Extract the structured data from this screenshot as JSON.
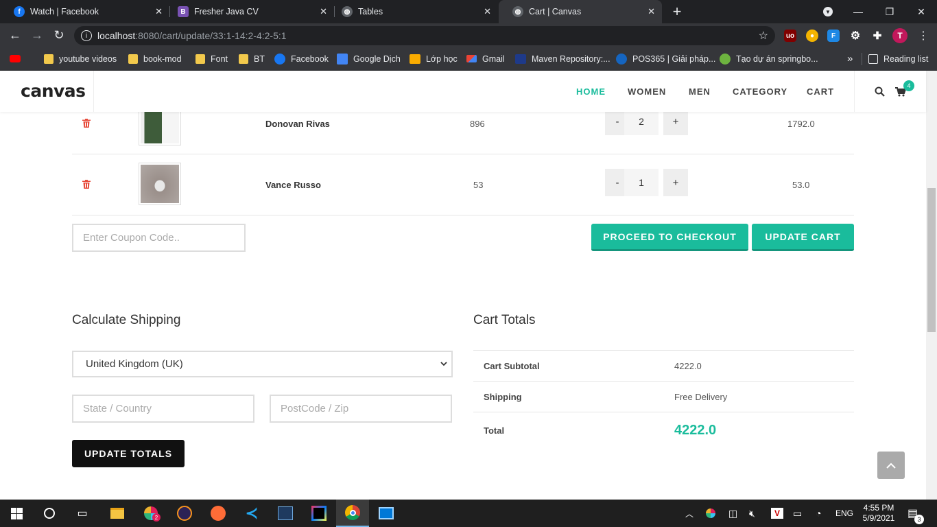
{
  "browser": {
    "tabs": [
      {
        "title": "Watch | Facebook",
        "icon": "facebook-icon"
      },
      {
        "title": "Fresher Java CV",
        "icon": "bootstrap-icon"
      },
      {
        "title": "Tables",
        "icon": "globe-icon"
      },
      {
        "title": "Cart | Canvas",
        "icon": "globe-icon",
        "active": true
      }
    ],
    "url_host": "localhost",
    "url_rest": ":8080/cart/update/33:1-14:2-4:2-5:1",
    "bookmarks": [
      "youtube videos",
      "book-mod",
      "Font",
      "BT",
      "Facebook",
      "Google Dịch",
      "Lớp học",
      "Gmail",
      "Maven Repository:...",
      "POS365 | Giải pháp...",
      "Tạo dự án springbo..."
    ],
    "bookmark_overflow": "»",
    "reading_list": "Reading list",
    "profile_initial": "T"
  },
  "site": {
    "logo": "canvas",
    "nav": [
      "HOME",
      "WOMEN",
      "MEN",
      "CATEGORY",
      "CART"
    ],
    "cart_count": "4",
    "accent": "#1abc9c"
  },
  "cart": {
    "items": [
      {
        "name": "Donovan Rivas",
        "price": "896",
        "qty": "2",
        "subtotal": "1792.0"
      },
      {
        "name": "Vance Russo",
        "price": "53",
        "qty": "1",
        "subtotal": "53.0"
      }
    ],
    "qty_minus": "-",
    "qty_plus": "+",
    "coupon_placeholder": "Enter Coupon Code..",
    "checkout_label": "PROCEED TO CHECKOUT",
    "update_cart_label": "UPDATE CART"
  },
  "shipping": {
    "heading": "Calculate Shipping",
    "country": "United Kingdom (UK)",
    "state_placeholder": "State / Country",
    "zip_placeholder": "PostCode / Zip",
    "update_totals_label": "UPDATE TOTALS"
  },
  "totals": {
    "heading": "Cart Totals",
    "rows": [
      {
        "label": "Cart Subtotal",
        "value": "4222.0"
      },
      {
        "label": "Shipping",
        "value": "Free Delivery"
      },
      {
        "label": "Total",
        "value": "4222.0"
      }
    ]
  },
  "taskbar": {
    "language": "ENG",
    "time": "4:55 PM",
    "date": "5/9/2021",
    "notification_count": "3",
    "slack_badge": "2"
  }
}
